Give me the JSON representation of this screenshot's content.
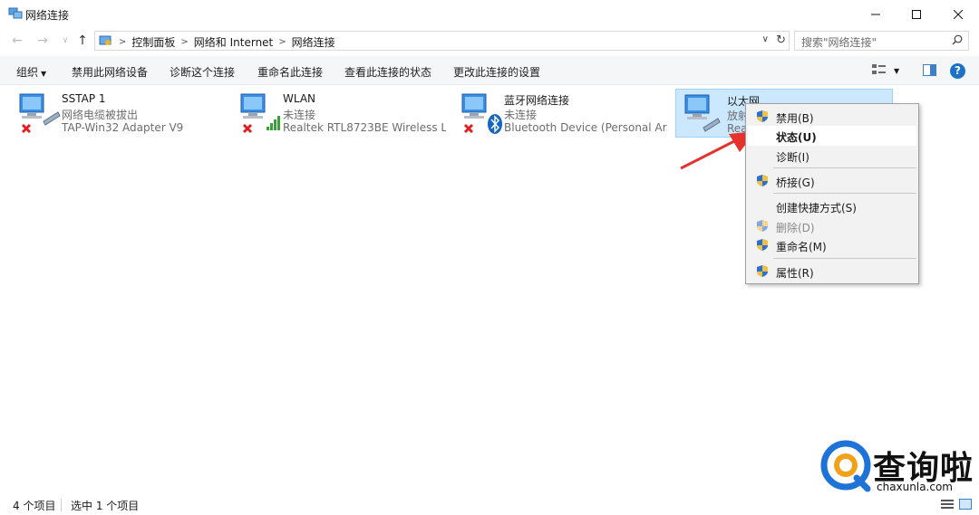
{
  "window": {
    "title": "网络连接",
    "controls": [
      "minimize",
      "maximize",
      "close"
    ]
  },
  "address_bar": {
    "breadcrumbs": [
      "控制面板",
      "网络和 Internet",
      "网络连接"
    ],
    "search_placeholder": "搜索\"网络连接\""
  },
  "command_bar": {
    "organize": "组织",
    "items": [
      "禁用此网络设备",
      "诊断这个连接",
      "重命名此连接",
      "查看此连接的状态",
      "更改此连接的设置"
    ]
  },
  "connections": [
    {
      "name": "SSTAP 1",
      "status": "网络电缆被拔出",
      "device": "TAP-Win32 Adapter V9",
      "icon": "ethernet-disconnected-icon"
    },
    {
      "name": "WLAN",
      "status": "未连接",
      "device": "Realtek RTL8723BE Wireless L...",
      "icon": "wifi-disconnected-icon"
    },
    {
      "name": "蓝牙网络连接",
      "status": "未连接",
      "device": "Bluetooth Device (Personal Ar...",
      "icon": "bluetooth-disconnected-icon"
    },
    {
      "name": "以太网",
      "status": "放射",
      "device": "Rea",
      "icon": "ethernet-icon",
      "selected": true
    }
  ],
  "context_menu": {
    "items": [
      {
        "label": "禁用(B)",
        "shield": true
      },
      {
        "label": "状态(U)",
        "bold": true,
        "hover": true
      },
      {
        "label": "诊断(I)"
      },
      {
        "label": "桥接(G)",
        "shield": true
      },
      {
        "label": "创建快捷方式(S)"
      },
      {
        "label": "删除(D)",
        "shield": true,
        "disabled": true
      },
      {
        "label": "重命名(M)",
        "shield": true
      },
      {
        "label": "属性(R)",
        "shield": true
      }
    ]
  },
  "status_bar": {
    "item_count": "4 个项目",
    "selected_count": "选中 1 个项目"
  },
  "watermark": {
    "brand": "查询啦",
    "domain": "chaxunla.com"
  },
  "colors": {
    "selection_bg": "#cce8ff",
    "help_blue": "#1a73c9",
    "annotation_red": "#e5322d",
    "watermark_blue": "#1e73d8"
  }
}
